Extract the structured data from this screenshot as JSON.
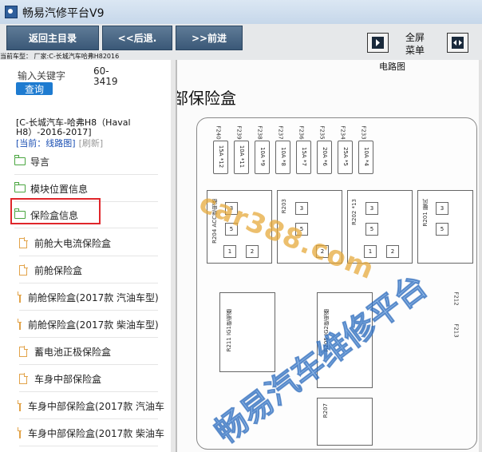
{
  "window": {
    "title": "畅易汽修平台V9"
  },
  "toolbar": {
    "home": "返回主目录",
    "back": "<<后退.",
    "forward": ">>前进",
    "fullscreen_line1": "全屏",
    "fullscreen_line2": "菜单"
  },
  "vehicle_bar": "当前车型： 厂家:C-长城汽车哈弗H82016",
  "sidebar": {
    "keyword_label": "输入关键字",
    "keyword_value_line1": "60-",
    "keyword_value_line2": "3419",
    "query_label": "查询",
    "model_text": "[C-长城汽车-哈弗H8（Haval H8）-2016-2017]",
    "crumb_current": "[当前：线路图]",
    "crumb_refresh": "[刷新]",
    "folders": [
      {
        "label": "导言"
      },
      {
        "label": "模块位置信息"
      },
      {
        "label": "保险盒信息"
      }
    ],
    "docs": [
      {
        "label": "前舱大电流保险盒"
      },
      {
        "label": "前舱保险盒"
      },
      {
        "label": "前舱保险盒(2017款 汽油车型)"
      },
      {
        "label": "前舱保险盒(2017款 柴油车型)"
      },
      {
        "label": "蓄电池正极保险盒"
      },
      {
        "label": "车身中部保险盒"
      },
      {
        "label": "车身中部保险盒(2017款 汽油车"
      },
      {
        "label": "车身中部保险盒(2017款 柴油车"
      }
    ]
  },
  "diagram": {
    "header": "电路图",
    "title": "部保险盒",
    "fuse_codes": [
      "F240",
      "F239",
      "F238",
      "F237",
      "F236",
      "F235",
      "F234",
      "F233"
    ],
    "fuse_ratings": [
      "15A *12",
      "10A *11",
      "10A *9",
      "10A *8",
      "15A *7",
      "20A *6",
      "25A *5",
      "10A *4"
    ],
    "relay_codes": [
      "R204 ACC继电器",
      "R203",
      "R202 *13",
      "R201 暖风"
    ],
    "lower_labels": [
      "R211 IG1继电器",
      "R205 IG2继电器",
      "R207",
      "F212",
      "F213"
    ],
    "pin_numbers": [
      "1",
      "2",
      "3",
      "5"
    ],
    "watermark_site": "car388.com",
    "watermark_cn": "畅易汽车维修平台"
  }
}
